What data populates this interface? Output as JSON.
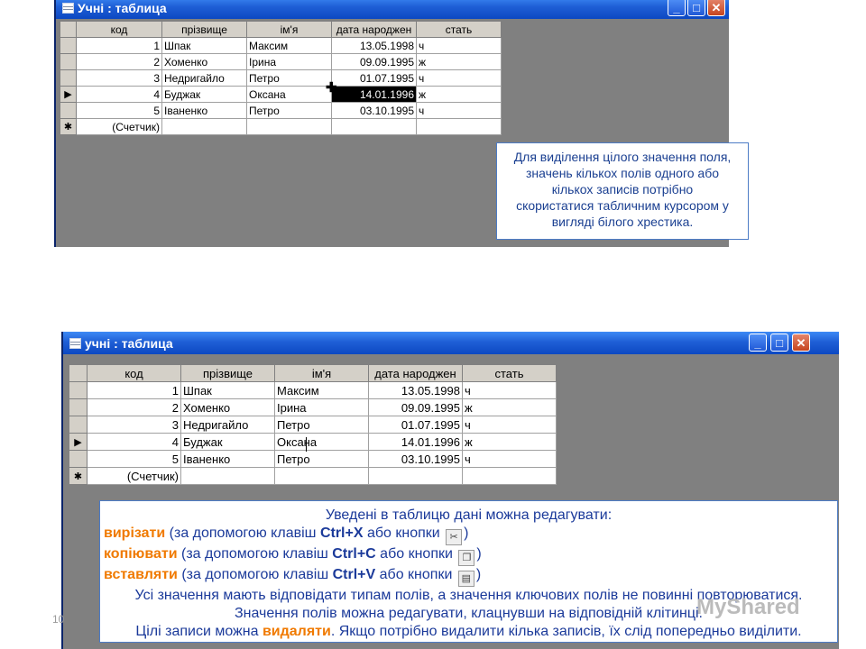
{
  "window1": {
    "title": "Учні : таблица",
    "buttons": {
      "minimize": "_",
      "maximize": "□",
      "close": "✕"
    },
    "columns": [
      "код",
      "прізвище",
      "ім'я",
      "дата народжен",
      "стать"
    ],
    "rows": [
      {
        "marker": "",
        "cells": [
          "1",
          "Шпак",
          "Максим",
          "13.05.1998",
          "ч"
        ]
      },
      {
        "marker": "",
        "cells": [
          "2",
          "Хоменко",
          "Ірина",
          "09.09.1995",
          "ж"
        ]
      },
      {
        "marker": "",
        "cells": [
          "3",
          "Недригайло",
          "Петро",
          "01.07.1995",
          "ч"
        ]
      },
      {
        "marker": "▶",
        "cells": [
          "4",
          "Буджак",
          "Оксана",
          "14.01.1996",
          "ж"
        ]
      },
      {
        "marker": "",
        "cells": [
          "5",
          "Іваненко",
          "Петро",
          "03.10.1995",
          "ч"
        ]
      },
      {
        "marker": "✱",
        "cells": [
          "(Счетчик)",
          "",
          "",
          "",
          ""
        ]
      }
    ],
    "note_lines": [
      "Для виділення цілого значення поля,",
      "значень кількох полів одного або",
      "кількох записів потрібно",
      "скористатися табличним курсором у",
      "вигляді білого хрестика."
    ]
  },
  "window2": {
    "title": "учні : таблица",
    "buttons": {
      "minimize": "_",
      "maximize": "□",
      "close": "✕"
    },
    "columns": [
      "код",
      "прізвище",
      "ім'я",
      "дата народжен",
      "стать"
    ],
    "rows": [
      {
        "marker": "",
        "cells": [
          "1",
          "Шпак",
          "Максим",
          "13.05.1998",
          "ч"
        ]
      },
      {
        "marker": "",
        "cells": [
          "2",
          "Хоменко",
          "Ірина",
          "09.09.1995",
          "ж"
        ]
      },
      {
        "marker": "",
        "cells": [
          "3",
          "Недригайло",
          "Петро",
          "01.07.1995",
          "ч"
        ]
      },
      {
        "marker": "▶",
        "cells": [
          "4",
          "Буджак",
          "Оксана",
          "14.01.1996",
          "ж"
        ]
      },
      {
        "marker": "",
        "cells": [
          "5",
          "Іваненко",
          "Петро",
          "03.10.1995",
          "ч"
        ]
      },
      {
        "marker": "✱",
        "cells": [
          "(Счетчик)",
          "",
          "",
          "",
          ""
        ]
      }
    ],
    "note": {
      "heading": "Уведені в таблицю дані можна редагувати:",
      "cut": {
        "kw": "вирізати",
        "t1": " (за допомогою клавіш ",
        "keys": "Ctrl+X",
        "t2": " або кнопки ",
        "t3": ")"
      },
      "copy": {
        "kw": "копіювати",
        "t1": " (за допомогою клавіш ",
        "keys": "Ctrl+C",
        "t2": " або кнопки ",
        "t3": ")"
      },
      "paste": {
        "kw": "вставляти",
        "t1": " (за допомогою клавіш ",
        "keys": "Ctrl+V",
        "t2": " або кнопки ",
        "t3": ")"
      },
      "line4": "Усі значення мають відповідати типам полів, а значення ключових полів не повинні повторюватися.",
      "line5": "Значення полів можна редагувати, клацнувши на відповідній клітинці.",
      "line6a": "Цілі записи можна ",
      "line6kw": "видаляти",
      "line6b": ". Якщо потрібно видалити кілька записів, їх слід попередньо виділити."
    }
  },
  "page_number": "10",
  "watermark": "MyShared",
  "icons": {
    "cut": "scissors-icon",
    "copy": "copy-icon",
    "paste": "paste-icon"
  },
  "colors": {
    "titlebar": "#1f5fd6",
    "note_text": "#1b3a9a",
    "keyword": "#f07a00",
    "highlight": "#000000"
  }
}
